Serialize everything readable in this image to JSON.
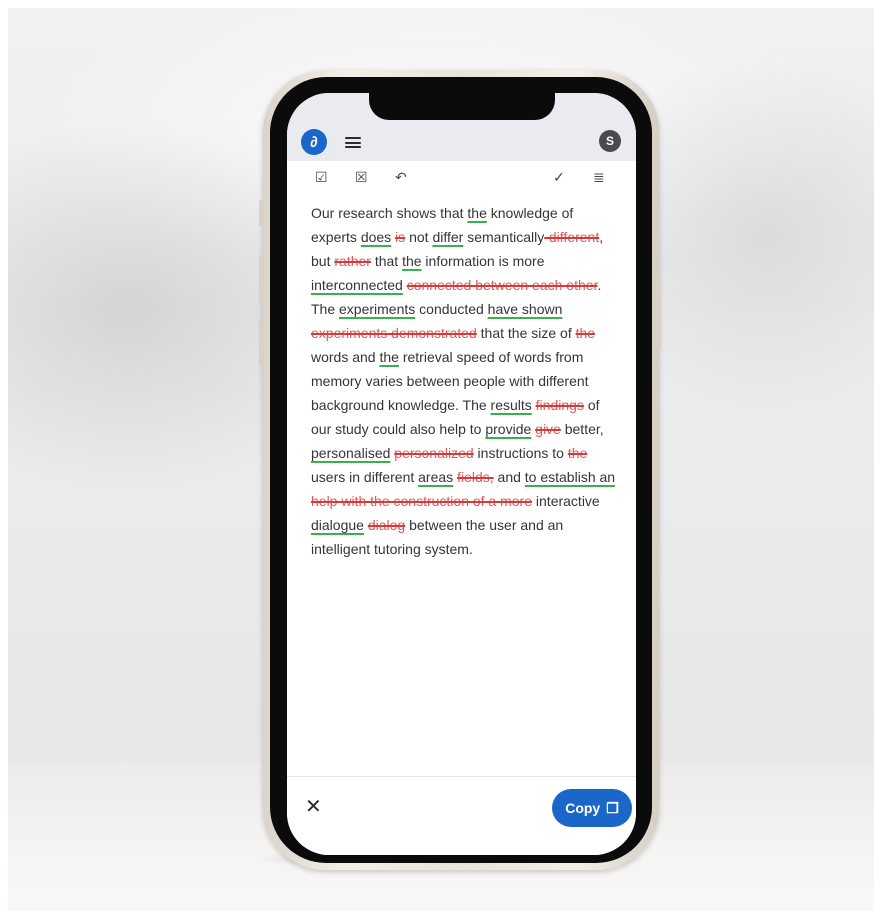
{
  "header": {
    "logo_glyph": "∂",
    "avatar_letter": "S",
    "accent_color": "#1b66c9"
  },
  "toolbar": {
    "accept_all_icon": "☑",
    "reject_all_icon": "☒",
    "undo_icon": "↶",
    "review_icon": "✓",
    "notes_icon": "≣"
  },
  "document": {
    "segments": [
      {
        "type": "text",
        "text": "Our research shows that "
      },
      {
        "type": "ins",
        "text": "the"
      },
      {
        "type": "text",
        "text": " knowledge of experts "
      },
      {
        "type": "ins",
        "text": "does"
      },
      {
        "type": "text",
        "text": " "
      },
      {
        "type": "del",
        "text": "is"
      },
      {
        "type": "text",
        "text": " not "
      },
      {
        "type": "ins",
        "text": "differ"
      },
      {
        "type": "text",
        "text": " semantically"
      },
      {
        "type": "del",
        "text": "-different"
      },
      {
        "type": "text",
        "text": ", but "
      },
      {
        "type": "del",
        "text": "rather"
      },
      {
        "type": "text",
        "text": " that "
      },
      {
        "type": "ins",
        "text": "the"
      },
      {
        "type": "text",
        "text": " information is more "
      },
      {
        "type": "ins",
        "text": "interconnected"
      },
      {
        "type": "text",
        "text": " "
      },
      {
        "type": "del",
        "text": "connected between each other"
      },
      {
        "type": "text",
        "text": ". The "
      },
      {
        "type": "ins",
        "text": "experiments"
      },
      {
        "type": "text",
        "text": " conducted "
      },
      {
        "type": "ins",
        "text": "have shown"
      },
      {
        "type": "text",
        "text": " "
      },
      {
        "type": "del",
        "text": "experiments demonstrated"
      },
      {
        "type": "text",
        "text": " that the size of "
      },
      {
        "type": "del",
        "text": "the"
      },
      {
        "type": "text",
        "text": " words and "
      },
      {
        "type": "ins",
        "text": "the"
      },
      {
        "type": "text",
        "text": " retrieval speed of words from memory varies between people with different background knowledge. The "
      },
      {
        "type": "ins",
        "text": "results"
      },
      {
        "type": "text",
        "text": " "
      },
      {
        "type": "del",
        "text": "findings"
      },
      {
        "type": "text",
        "text": " of our study could also help to "
      },
      {
        "type": "ins",
        "text": "provide"
      },
      {
        "type": "text",
        "text": " "
      },
      {
        "type": "del",
        "text": "give"
      },
      {
        "type": "text",
        "text": " better, "
      },
      {
        "type": "ins",
        "text": "personalised"
      },
      {
        "type": "text",
        "text": " "
      },
      {
        "type": "del",
        "text": "personalized"
      },
      {
        "type": "text",
        "text": " instructions to "
      },
      {
        "type": "del",
        "text": "the"
      },
      {
        "type": "text",
        "text": " users in different "
      },
      {
        "type": "ins",
        "text": "areas"
      },
      {
        "type": "text",
        "text": " "
      },
      {
        "type": "del",
        "text": "fields,"
      },
      {
        "type": "text",
        "text": " and "
      },
      {
        "type": "ins",
        "text": "to establish an"
      },
      {
        "type": "text",
        "text": " "
      },
      {
        "type": "del",
        "text": "help with the construction of a more"
      },
      {
        "type": "text",
        "text": " interactive "
      },
      {
        "type": "ins",
        "text": "dialogue"
      },
      {
        "type": "text",
        "text": " "
      },
      {
        "type": "del",
        "text": "dialog"
      },
      {
        "type": "text",
        "text": " between the user and an intelligent tutoring system."
      }
    ]
  },
  "footer": {
    "close_glyph": "✕",
    "copy_label": "Copy",
    "copy_icon": "❐"
  }
}
